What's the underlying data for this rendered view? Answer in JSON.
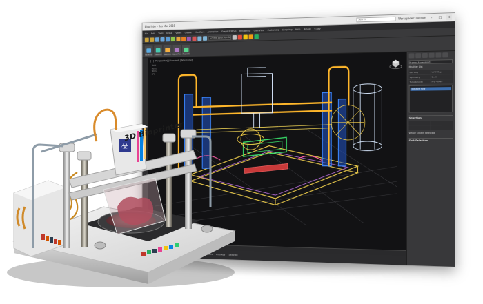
{
  "window": {
    "app_title": "Bioprinter - 3ds Max 2018",
    "search_placeholder": "Search",
    "workspace_label": "Workspaces: Default",
    "controls": [
      "–",
      "□",
      "✕"
    ]
  },
  "menubar": [
    "File",
    "Edit",
    "Tools",
    "Group",
    "Views",
    "Create",
    "Modifiers",
    "Animation",
    "Graph Editors",
    "Rendering",
    "Civil View",
    "Customize",
    "Scripting",
    "Help",
    "Arnold",
    "V-Ray"
  ],
  "toolbar": {
    "selection_set": "Create Selection Set"
  },
  "ribbon": [
    "Modeling",
    "Freeform",
    "Selection",
    "Object Paint",
    "Populate"
  ],
  "viewport": {
    "label": "[+] [Perspective] [Standard] [Wireframe]",
    "stats": [
      "Total",
      "Polys",
      "Verts",
      "FPS"
    ]
  },
  "command_panel": {
    "object_name": "Frame_Assembly01",
    "modifier_list": "Modifier List",
    "buttons": [
      "Edit Poly",
      "UVW Map",
      "Symmetry",
      "Shell",
      "TurboSmooth",
      "FFD 4x4x4"
    ],
    "stack_item": "Editable Poly",
    "sections": [
      "Selection",
      "Soft Selection"
    ],
    "selection_note": "Whole Object Selected"
  },
  "statusbar": [
    "1 Object Selected",
    "Click or click-and-drag to select objects",
    "Auto Key",
    "Selected"
  ],
  "device": {
    "label": "3D Bioprinter"
  }
}
